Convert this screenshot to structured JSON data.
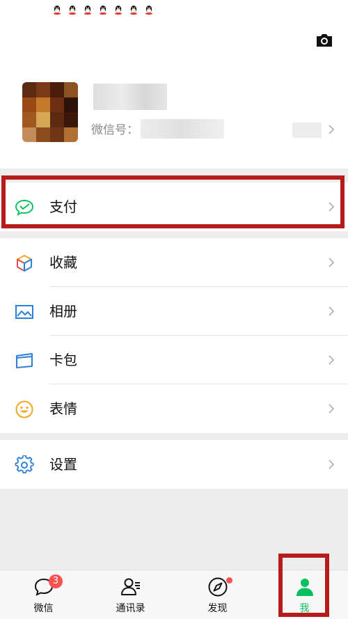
{
  "status_bar": {
    "icons": [
      "qq-icon",
      "qq-icon",
      "qq-icon",
      "qq-icon",
      "qq-icon",
      "qq-icon",
      "qq-icon"
    ]
  },
  "profile": {
    "wxid_label": "微信号："
  },
  "menu": {
    "pay": {
      "label": "支付"
    },
    "favorites": {
      "label": "收藏"
    },
    "album": {
      "label": "相册"
    },
    "cards": {
      "label": "卡包"
    },
    "stickers": {
      "label": "表情"
    },
    "settings": {
      "label": "设置"
    }
  },
  "tabbar": {
    "chats": {
      "label": "微信",
      "badge": "3"
    },
    "contacts": {
      "label": "通讯录"
    },
    "discover": {
      "label": "发现"
    },
    "me": {
      "label": "我"
    }
  },
  "colors": {
    "accent": "#07c160",
    "highlight": "#b71c1c",
    "badge": "#fa5151"
  }
}
